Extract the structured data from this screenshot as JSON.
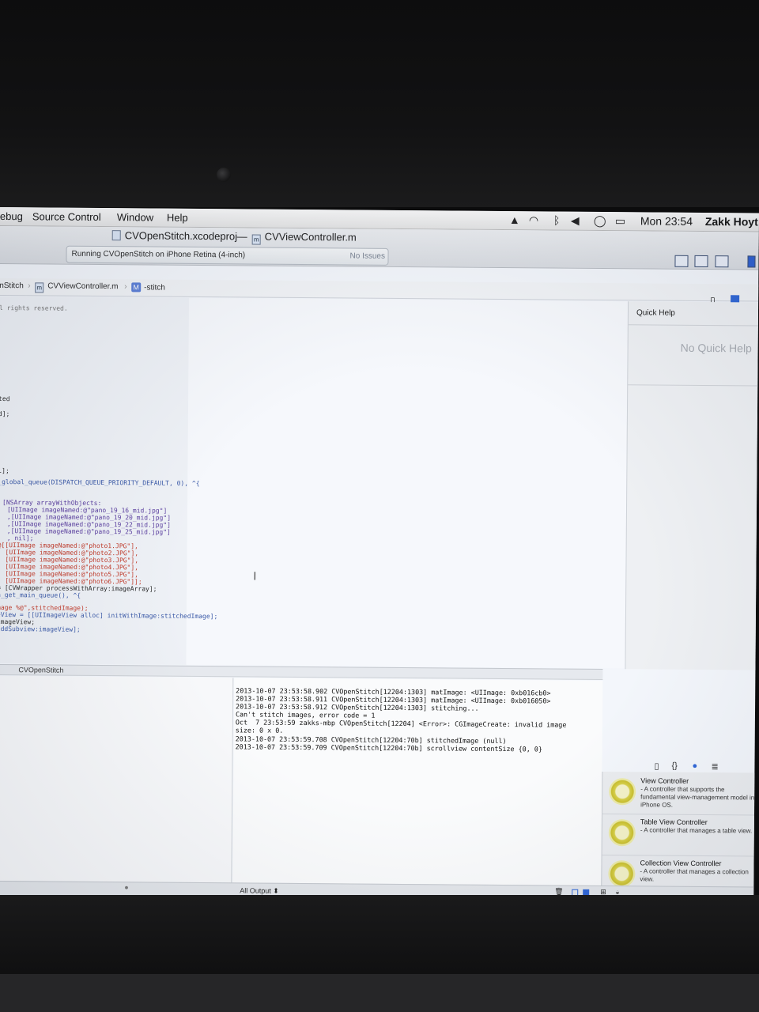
{
  "menubar": {
    "items": [
      "ebug",
      "Source Control",
      "Window",
      "Help"
    ],
    "clock": "Mon 23:54",
    "user": "Zakk Hoyt"
  },
  "toolbar": {
    "project_title": "CVOpenStitch.xcodeproj",
    "separator": "—",
    "file_title": "CVViewController.m",
    "activity_text": "Running CVOpenStitch on iPhone Retina (4-inch)",
    "issues_text": "No Issues"
  },
  "jumpbar": {
    "project": "nStitch",
    "file": "CVViewController.m",
    "method": "-stitch"
  },
  "editor": {
    "lines": [
      "l rights reserved.",
      "ted",
      "d];",
      "l];",
      "_global_queue(DISPATCH_QUEUE_PRIORITY_DEFAULT, 0), ^{",
      "[NSArray arrayWithObjects:",
      "[UIImage imageNamed:@\"pano_19_16_mid.jpg\"]",
      ",[UIImage imageNamed:@\"pano_19_20_mid.jpg\"]",
      ",[UIImage imageNamed:@\"pano_19_22_mid.jpg\"]",
      ",[UIImage imageNamed:@\"pano_19_25_mid.jpg\"]",
      ", nil];",
      "@[[UIImage imageNamed:@\"photo1.JPG\"],",
      "[UIImage imageNamed:@\"photo2.JPG\"],",
      "[UIImage imageNamed:@\"photo3.JPG\"],",
      "[UIImage imageNamed:@\"photo4.JPG\"],",
      "[UIImage imageNamed:@\"photo5.JPG\"],",
      "[UIImage imageNamed:@\"photo6.JPG\"]];",
      "= [CVWrapper processWithArray:imageArray];",
      "h_get_main_queue(), ^{",
      "mage %@\",stitchedImage);",
      "eView = [[UIImageView alloc] initWithImage:stitchedImage];",
      "imageView;",
      "addSubview:imageView];"
    ]
  },
  "inspector": {
    "title": "Quick Help",
    "empty_text": "No Quick Help"
  },
  "library": {
    "items": [
      {
        "title": "View Controller",
        "desc": " - A controller that supports the fundamental view-management model in iPhone OS."
      },
      {
        "title": "Table View Controller",
        "desc": " - A controller that manages a table view."
      },
      {
        "title": "Collection View Controller",
        "desc": " - A controller that manages a collection view."
      }
    ]
  },
  "debug": {
    "target": "CVOpenStitch",
    "output_selector": "All Output ⬍",
    "console_lines": [
      "2013-10-07 23:53:58.902 CVOpenStitch[12204:1303] matImage: <UIImage: 0xb016cb0>",
      "2013-10-07 23:53:58.911 CVOpenStitch[12204:1303] matImage: <UIImage: 0xb016050>",
      "2013-10-07 23:53:58.912 CVOpenStitch[12204:1303] stitching...",
      "Can't stitch images, error code = 1",
      "Oct  7 23:53:59 zakks-mbp CVOpenStitch[12204] <Error>: CGImageCreate: invalid image",
      "size: 0 x 0.",
      "2013-10-07 23:53:59.708 CVOpenStitch[12204:70b] stitchedImage (null)",
      "2013-10-07 23:53:59.709 CVOpenStitch[12204:70b] scrollview contentSize {0, 0}"
    ]
  }
}
